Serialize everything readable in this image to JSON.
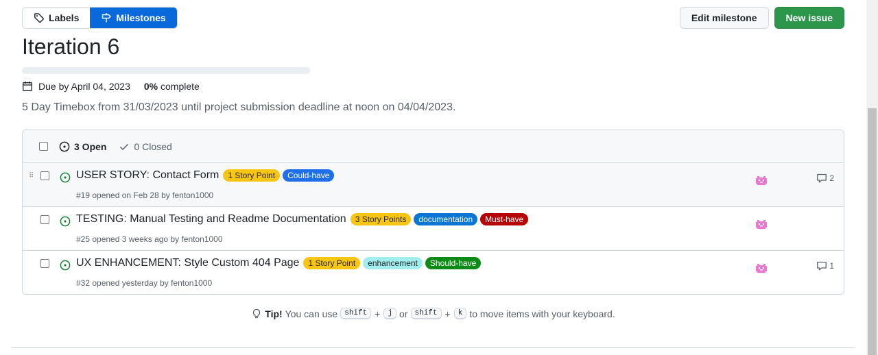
{
  "header": {
    "labels_tab": "Labels",
    "milestones_tab": "Milestones",
    "edit_button": "Edit milestone",
    "new_issue_button": "New issue"
  },
  "milestone": {
    "title": "Iteration 6",
    "progress_percent": 0,
    "due": "Due by April 04, 2023",
    "percent_value": "0%",
    "percent_label": " complete",
    "description": "5 Day Timebox from 31/03/2023 until project submission deadline at noon on 04/04/2023."
  },
  "list": {
    "open_label": "3 Open",
    "closed_label": "0 Closed",
    "issues": [
      {
        "title": "USER STORY: Contact Form",
        "meta": "#19 opened on Feb 28 by fenton1000",
        "labels": [
          {
            "text": "1 Story Point",
            "bg": "#f9c513",
            "fg": "#1f2328"
          },
          {
            "text": "Could-have",
            "bg": "#1f6feb",
            "fg": "#ffffff"
          }
        ],
        "comments": "2"
      },
      {
        "title": "TESTING: Manual Testing and Readme Documentation",
        "meta": "#25 opened 3 weeks ago by fenton1000",
        "labels": [
          {
            "text": "3 Story Points",
            "bg": "#f9c513",
            "fg": "#1f2328"
          },
          {
            "text": "documentation",
            "bg": "#0b76d4",
            "fg": "#ffffff"
          },
          {
            "text": "Must-have",
            "bg": "#b60205",
            "fg": "#ffffff"
          }
        ],
        "comments": ""
      },
      {
        "title": "UX ENHANCEMENT: Style Custom 404 Page",
        "meta": "#32 opened yesterday by fenton1000",
        "labels": [
          {
            "text": "1 Story Point",
            "bg": "#f9c513",
            "fg": "#1f2328"
          },
          {
            "text": "enhancement",
            "bg": "#a2eeef",
            "fg": "#1f2328"
          },
          {
            "text": "Should-have",
            "bg": "#0e8a16",
            "fg": "#ffffff"
          }
        ],
        "comments": "1"
      }
    ]
  },
  "tip": {
    "bold": "Tip!",
    "text1": "You can use",
    "key_shift": "shift",
    "plus": "+",
    "key_j": "j",
    "or": "or",
    "key_k": "k",
    "text2": "to move items with your keyboard."
  },
  "colors": {
    "accent": "#0969da",
    "open_green": "#1a7f37",
    "avatar_pink": "#e57ad0"
  }
}
